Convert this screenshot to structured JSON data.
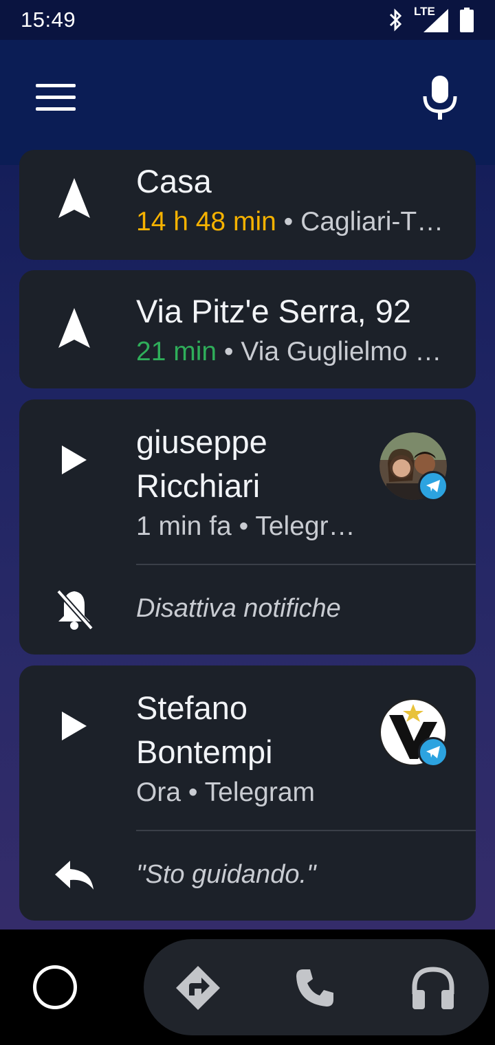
{
  "status_bar": {
    "time": "15:49",
    "network": "LTE"
  },
  "app_bar": {
    "menu_icon": "hamburger-menu-icon",
    "mic_icon": "microphone-icon"
  },
  "cards": [
    {
      "type": "navigation",
      "title": "Casa",
      "eta": "14 h 48 min",
      "separator": "•",
      "detail": "Cagliari-T…",
      "eta_color": "#f6b200"
    },
    {
      "type": "navigation",
      "title": "Via Pitz'e Serra, 92",
      "eta": "21 min",
      "separator": "•",
      "detail": "Via Guglielmo …",
      "eta_color": "#2fae5a"
    },
    {
      "type": "message",
      "name_line1": "giuseppe",
      "name_line2": "Ricchiari",
      "meta": "1 min fa • Telegr…",
      "action": "Disattiva notifiche",
      "action_icon": "bell-off-icon"
    },
    {
      "type": "message",
      "name_line1": "Stefano",
      "name_line2": "Bontempi",
      "meta": "Ora • Telegram",
      "action": "\"Sto guidando.\"",
      "action_icon": "reply-icon"
    }
  ],
  "bottom_nav": {
    "home_icon": "home-circle-icon",
    "dock": [
      "navigation-icon",
      "phone-icon",
      "headphones-icon"
    ]
  },
  "colors": {
    "accent_orange": "#f6b200",
    "accent_green": "#2fae5a",
    "telegram_blue": "#2ca3e0"
  }
}
